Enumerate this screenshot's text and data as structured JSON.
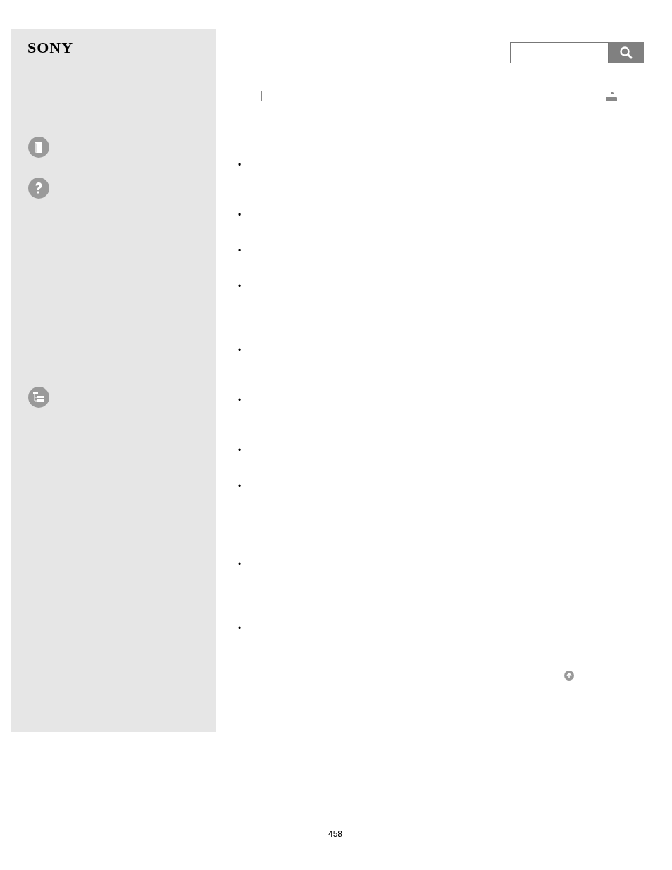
{
  "sidebar": {
    "logo": "SONY",
    "nav_icons": [
      {
        "kind": "book"
      },
      {
        "kind": "help"
      },
      {
        "kind": "tree"
      }
    ]
  },
  "content": {
    "bullets": [
      "•",
      "•",
      "•",
      "•",
      "•",
      "•",
      "•",
      "•",
      "•",
      "•"
    ]
  },
  "page_number": "458"
}
